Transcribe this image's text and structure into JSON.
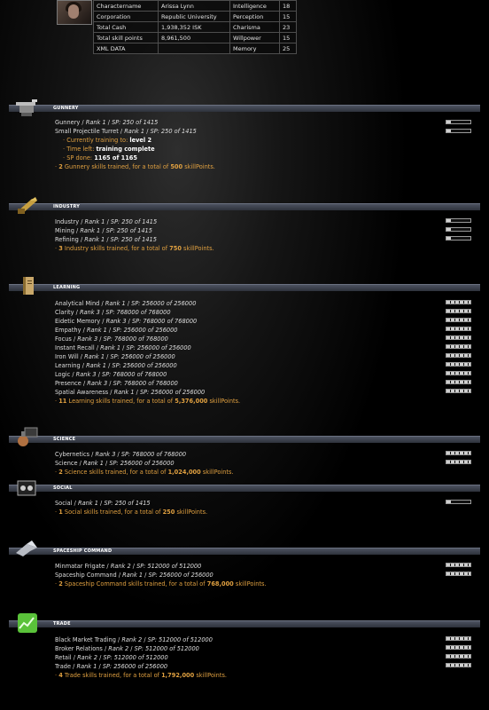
{
  "character": {
    "rows": [
      {
        "label": "Charactername",
        "value": "Arissa Lynn",
        "attr": "Intelligence",
        "attr_value": "18"
      },
      {
        "label": "Corporation",
        "value": "Republic University",
        "attr": "Perception",
        "attr_value": "15"
      },
      {
        "label": "Total Cash",
        "value": "1,938,352 ISK",
        "attr": "Charisma",
        "attr_value": "23"
      },
      {
        "label": "Total skill points",
        "value": "8,961,500",
        "attr": "Willpower",
        "attr_value": "15"
      },
      {
        "label": "XML DATA",
        "value": "",
        "attr": "Memory",
        "attr_value": "25"
      }
    ]
  },
  "colors": {
    "accent": "#d98a2b",
    "bar": "#4c5260",
    "text": "#dedede"
  },
  "sections": {
    "gunnery": {
      "title": "GUNNERY",
      "skills": [
        {
          "name": "Gunnery",
          "rank": "Rank 1",
          "sp": "SP: 250 of 1415",
          "level": 0.2
        },
        {
          "name": "Small Projectile Turret",
          "rank": "Rank 1",
          "sp": "SP: 250 of 1415",
          "level": 0.2
        }
      ],
      "training": {
        "to_label": "Currently training to:",
        "to_value": "level 2",
        "left_label": "Time left:",
        "left_value": "training complete",
        "done_label": "SP done:",
        "done_value": "1165 of 1165"
      },
      "summary": {
        "count": "2",
        "text": "Gunnery skills trained, for a total of",
        "points": "500",
        "unit": "skillPoints."
      }
    },
    "industry": {
      "title": "INDUSTRY",
      "skills": [
        {
          "name": "Industry",
          "rank": "Rank 1",
          "sp": "SP: 250 of 1415",
          "level": 0.2
        },
        {
          "name": "Mining",
          "rank": "Rank 1",
          "sp": "SP: 250 of 1415",
          "level": 0.2
        },
        {
          "name": "Refining",
          "rank": "Rank 1",
          "sp": "SP: 250 of 1415",
          "level": 0.2
        }
      ],
      "summary": {
        "count": "3",
        "text": "Industry skills trained, for a total of",
        "points": "750",
        "unit": "skillPoints."
      }
    },
    "learning": {
      "title": "LEARNING",
      "skills": [
        {
          "name": "Analytical Mind",
          "rank": "Rank 1",
          "sp": "SP: 256000 of 256000",
          "level": 1
        },
        {
          "name": "Clarity",
          "rank": "Rank 3",
          "sp": "SP: 768000 of 768000",
          "level": 1
        },
        {
          "name": "Eidetic Memory",
          "rank": "Rank 3",
          "sp": "SP: 768000 of 768000",
          "level": 1
        },
        {
          "name": "Empathy",
          "rank": "Rank 1",
          "sp": "SP: 256000 of 256000",
          "level": 1
        },
        {
          "name": "Focus",
          "rank": "Rank 3",
          "sp": "SP: 768000 of 768000",
          "level": 1
        },
        {
          "name": "Instant Recall",
          "rank": "Rank 1",
          "sp": "SP: 256000 of 256000",
          "level": 1
        },
        {
          "name": "Iron Will",
          "rank": "Rank 1",
          "sp": "SP: 256000 of 256000",
          "level": 1
        },
        {
          "name": "Learning",
          "rank": "Rank 1",
          "sp": "SP: 256000 of 256000",
          "level": 1
        },
        {
          "name": "Logic",
          "rank": "Rank 3",
          "sp": "SP: 768000 of 768000",
          "level": 1
        },
        {
          "name": "Presence",
          "rank": "Rank 3",
          "sp": "SP: 768000 of 768000",
          "level": 1
        },
        {
          "name": "Spatial Awareness",
          "rank": "Rank 1",
          "sp": "SP: 256000 of 256000",
          "level": 1
        }
      ],
      "summary": {
        "count": "11",
        "text": "Learning skills trained, for a total of",
        "points": "5,376,000",
        "unit": "skillPoints."
      }
    },
    "science": {
      "title": "SCIENCE",
      "skills": [
        {
          "name": "Cybernetics",
          "rank": "Rank 3",
          "sp": "SP: 768000 of 768000",
          "level": 1
        },
        {
          "name": "Science",
          "rank": "Rank 1",
          "sp": "SP: 256000 of 256000",
          "level": 1
        }
      ],
      "summary": {
        "count": "2",
        "text": "Science skills trained, for a total of",
        "points": "1,024,000",
        "unit": "skillPoints."
      }
    },
    "social": {
      "title": "SOCIAL",
      "skills": [
        {
          "name": "Social",
          "rank": "Rank 1",
          "sp": "SP: 250 of 1415",
          "level": 0.2
        }
      ],
      "summary": {
        "count": "1",
        "text": "Social skills trained, for a total of",
        "points": "250",
        "unit": "skillPoints."
      }
    },
    "spaceship": {
      "title": "SPACESHIP COMMAND",
      "skills": [
        {
          "name": "Minmatar Frigate",
          "rank": "Rank 2",
          "sp": "SP: 512000 of 512000",
          "level": 1
        },
        {
          "name": "Spaceship Command",
          "rank": "Rank 1",
          "sp": "SP: 256000 of 256000",
          "level": 1
        }
      ],
      "summary": {
        "count": "2",
        "text": "Spaceship Command skills trained, for a total of",
        "points": "768,000",
        "unit": "skillPoints."
      }
    },
    "trade": {
      "title": "TRADE",
      "skills": [
        {
          "name": "Black Market Trading",
          "rank": "Rank 2",
          "sp": "SP: 512000 of 512000",
          "level": 1
        },
        {
          "name": "Broker Relations",
          "rank": "Rank 2",
          "sp": "SP: 512000 of 512000",
          "level": 1
        },
        {
          "name": "Retail",
          "rank": "Rank 2",
          "sp": "SP: 512000 of 512000",
          "level": 1
        },
        {
          "name": "Trade",
          "rank": "Rank 1",
          "sp": "SP: 256000 of 256000",
          "level": 1
        }
      ],
      "summary": {
        "count": "4",
        "text": "Trade skills trained, for a total of",
        "points": "1,792,000",
        "unit": "skillPoints."
      }
    }
  }
}
